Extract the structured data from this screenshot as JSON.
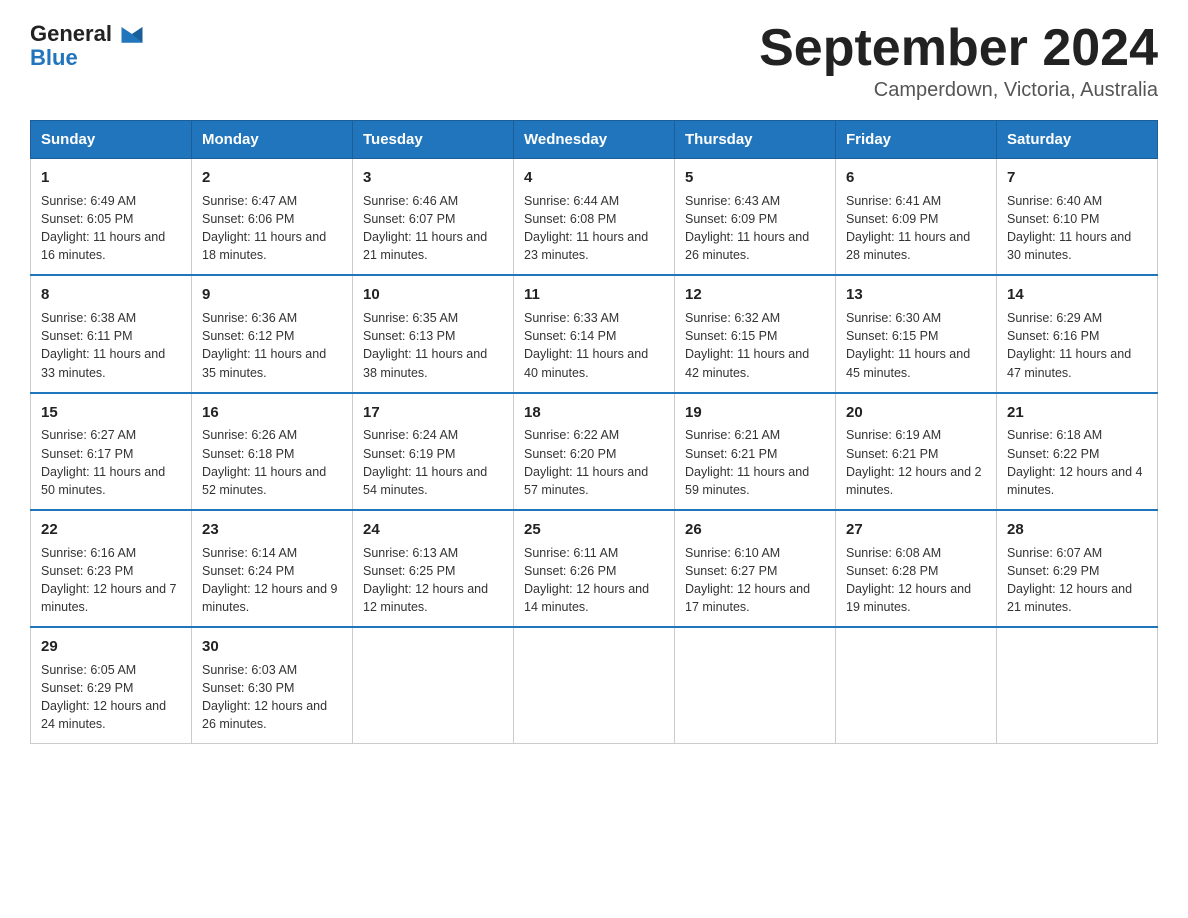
{
  "header": {
    "logo_text_general": "General",
    "logo_text_blue": "Blue",
    "month_title": "September 2024",
    "location": "Camperdown, Victoria, Australia"
  },
  "weekdays": [
    "Sunday",
    "Monday",
    "Tuesday",
    "Wednesday",
    "Thursday",
    "Friday",
    "Saturday"
  ],
  "weeks": [
    [
      {
        "day": "1",
        "sunrise": "6:49 AM",
        "sunset": "6:05 PM",
        "daylight": "11 hours and 16 minutes."
      },
      {
        "day": "2",
        "sunrise": "6:47 AM",
        "sunset": "6:06 PM",
        "daylight": "11 hours and 18 minutes."
      },
      {
        "day": "3",
        "sunrise": "6:46 AM",
        "sunset": "6:07 PM",
        "daylight": "11 hours and 21 minutes."
      },
      {
        "day": "4",
        "sunrise": "6:44 AM",
        "sunset": "6:08 PM",
        "daylight": "11 hours and 23 minutes."
      },
      {
        "day": "5",
        "sunrise": "6:43 AM",
        "sunset": "6:09 PM",
        "daylight": "11 hours and 26 minutes."
      },
      {
        "day": "6",
        "sunrise": "6:41 AM",
        "sunset": "6:09 PM",
        "daylight": "11 hours and 28 minutes."
      },
      {
        "day": "7",
        "sunrise": "6:40 AM",
        "sunset": "6:10 PM",
        "daylight": "11 hours and 30 minutes."
      }
    ],
    [
      {
        "day": "8",
        "sunrise": "6:38 AM",
        "sunset": "6:11 PM",
        "daylight": "11 hours and 33 minutes."
      },
      {
        "day": "9",
        "sunrise": "6:36 AM",
        "sunset": "6:12 PM",
        "daylight": "11 hours and 35 minutes."
      },
      {
        "day": "10",
        "sunrise": "6:35 AM",
        "sunset": "6:13 PM",
        "daylight": "11 hours and 38 minutes."
      },
      {
        "day": "11",
        "sunrise": "6:33 AM",
        "sunset": "6:14 PM",
        "daylight": "11 hours and 40 minutes."
      },
      {
        "day": "12",
        "sunrise": "6:32 AM",
        "sunset": "6:15 PM",
        "daylight": "11 hours and 42 minutes."
      },
      {
        "day": "13",
        "sunrise": "6:30 AM",
        "sunset": "6:15 PM",
        "daylight": "11 hours and 45 minutes."
      },
      {
        "day": "14",
        "sunrise": "6:29 AM",
        "sunset": "6:16 PM",
        "daylight": "11 hours and 47 minutes."
      }
    ],
    [
      {
        "day": "15",
        "sunrise": "6:27 AM",
        "sunset": "6:17 PM",
        "daylight": "11 hours and 50 minutes."
      },
      {
        "day": "16",
        "sunrise": "6:26 AM",
        "sunset": "6:18 PM",
        "daylight": "11 hours and 52 minutes."
      },
      {
        "day": "17",
        "sunrise": "6:24 AM",
        "sunset": "6:19 PM",
        "daylight": "11 hours and 54 minutes."
      },
      {
        "day": "18",
        "sunrise": "6:22 AM",
        "sunset": "6:20 PM",
        "daylight": "11 hours and 57 minutes."
      },
      {
        "day": "19",
        "sunrise": "6:21 AM",
        "sunset": "6:21 PM",
        "daylight": "11 hours and 59 minutes."
      },
      {
        "day": "20",
        "sunrise": "6:19 AM",
        "sunset": "6:21 PM",
        "daylight": "12 hours and 2 minutes."
      },
      {
        "day": "21",
        "sunrise": "6:18 AM",
        "sunset": "6:22 PM",
        "daylight": "12 hours and 4 minutes."
      }
    ],
    [
      {
        "day": "22",
        "sunrise": "6:16 AM",
        "sunset": "6:23 PM",
        "daylight": "12 hours and 7 minutes."
      },
      {
        "day": "23",
        "sunrise": "6:14 AM",
        "sunset": "6:24 PM",
        "daylight": "12 hours and 9 minutes."
      },
      {
        "day": "24",
        "sunrise": "6:13 AM",
        "sunset": "6:25 PM",
        "daylight": "12 hours and 12 minutes."
      },
      {
        "day": "25",
        "sunrise": "6:11 AM",
        "sunset": "6:26 PM",
        "daylight": "12 hours and 14 minutes."
      },
      {
        "day": "26",
        "sunrise": "6:10 AM",
        "sunset": "6:27 PM",
        "daylight": "12 hours and 17 minutes."
      },
      {
        "day": "27",
        "sunrise": "6:08 AM",
        "sunset": "6:28 PM",
        "daylight": "12 hours and 19 minutes."
      },
      {
        "day": "28",
        "sunrise": "6:07 AM",
        "sunset": "6:29 PM",
        "daylight": "12 hours and 21 minutes."
      }
    ],
    [
      {
        "day": "29",
        "sunrise": "6:05 AM",
        "sunset": "6:29 PM",
        "daylight": "12 hours and 24 minutes."
      },
      {
        "day": "30",
        "sunrise": "6:03 AM",
        "sunset": "6:30 PM",
        "daylight": "12 hours and 26 minutes."
      },
      null,
      null,
      null,
      null,
      null
    ]
  ]
}
